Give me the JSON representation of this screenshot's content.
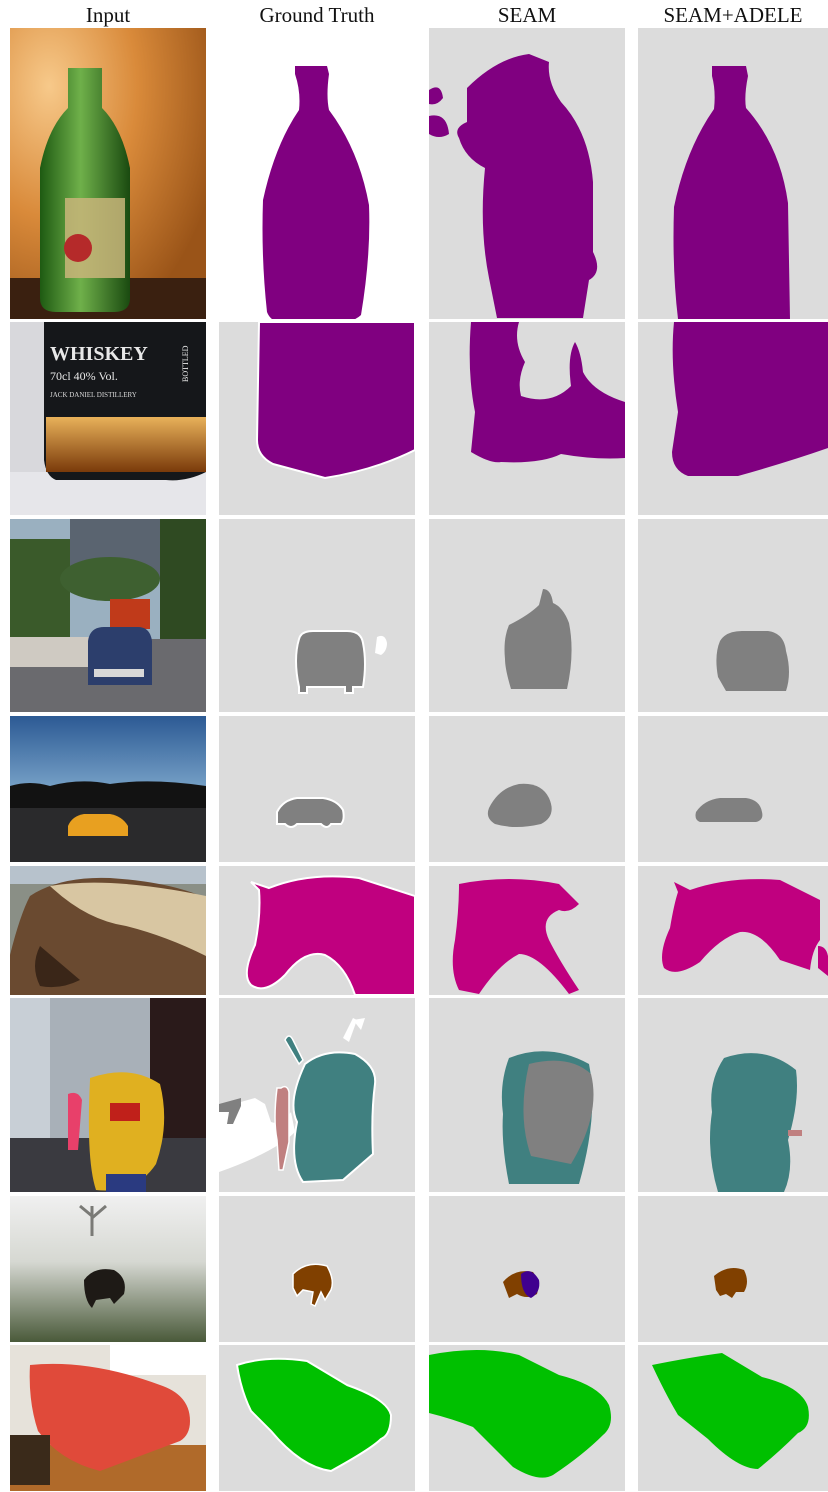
{
  "figure": {
    "columns": [
      "Input",
      "Ground Truth",
      "SEAM",
      "SEAM+ADELE"
    ]
  },
  "colors": {
    "background_gt": "#ffffff",
    "background_mask": "#dcdcdc",
    "bottle": "#800080",
    "car": "#808080",
    "horse": "#c0007f",
    "motorbike": "#408080",
    "person": "#c08080",
    "dog": "#804000",
    "cat_error": "#40008f",
    "sofa": "#00c000",
    "boundary": "#ffffff"
  },
  "rows": [
    {
      "id": "bottle-row",
      "photo_icon": "green-bottle-photo"
    },
    {
      "id": "whiskey-row",
      "photo_icon": "whiskey-bottle-photo",
      "photo_text": [
        "WHISKEY",
        "70cl   40% Vol.",
        "JACK DANIEL DISTILLERY",
        "BOTTLED"
      ]
    },
    {
      "id": "car-street-row",
      "photo_icon": "car-street-photo"
    },
    {
      "id": "car-dusk-row",
      "photo_icon": "yellow-car-photo"
    },
    {
      "id": "horse-row",
      "photo_icon": "horse-photo"
    },
    {
      "id": "scooter-row",
      "photo_icon": "scooter-photo"
    },
    {
      "id": "dog-field-row",
      "photo_icon": "dog-fog-photo"
    },
    {
      "id": "sofa-row",
      "photo_icon": "sofa-photo"
    }
  ]
}
